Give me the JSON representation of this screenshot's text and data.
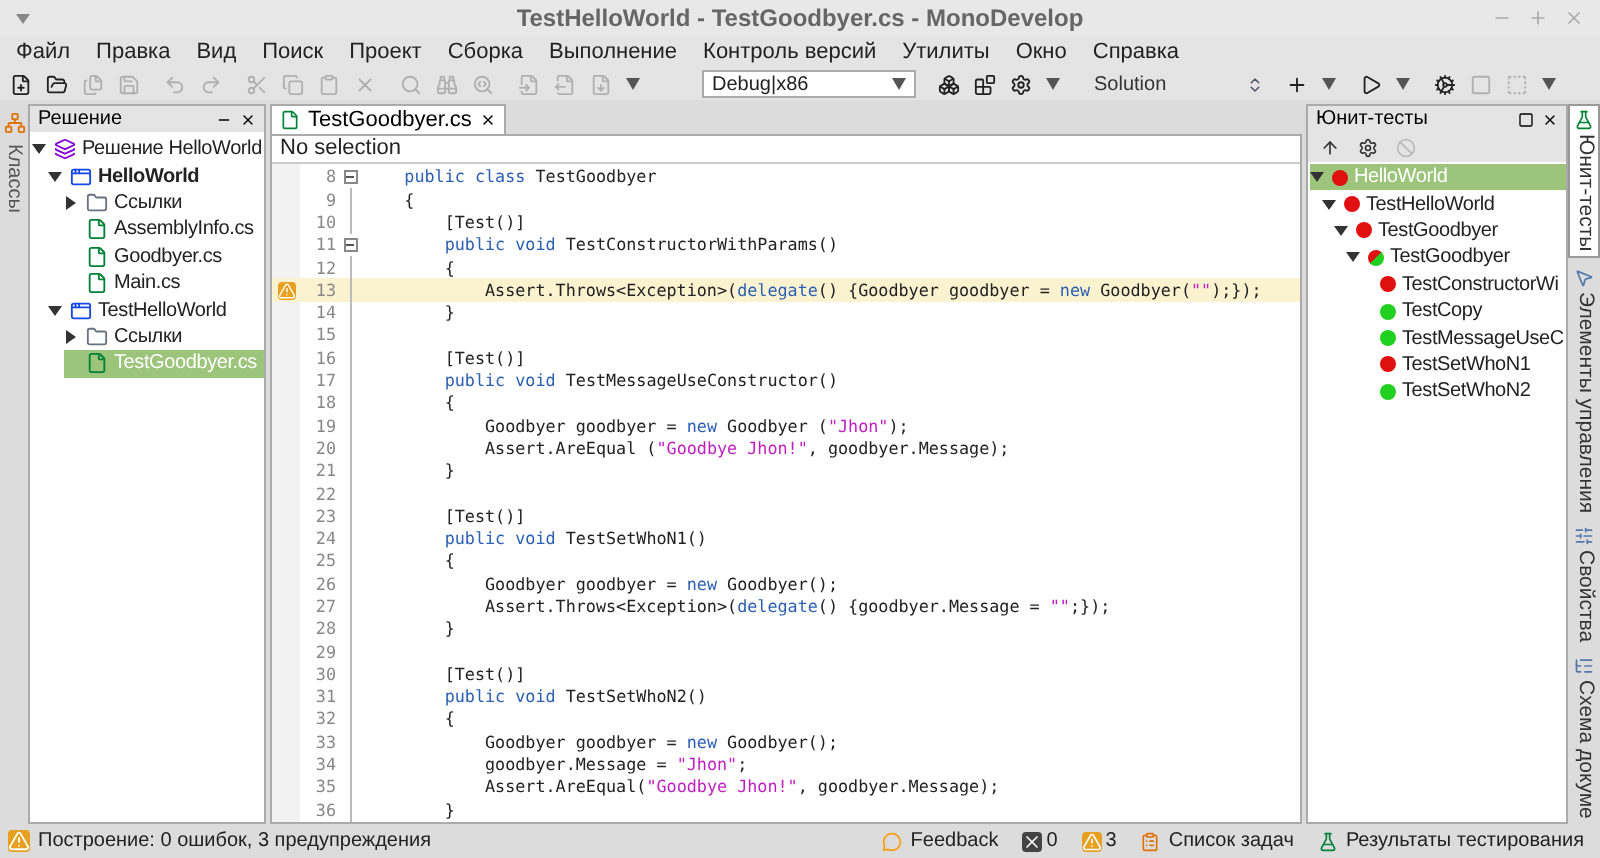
{
  "window": {
    "title": "TestHelloWorld - TestGoodbyer.cs - MonoDevelop"
  },
  "menu": [
    "Файл",
    "Правка",
    "Вид",
    "Поиск",
    "Проект",
    "Сборка",
    "Выполнение",
    "Контроль версий",
    "Утилиты",
    "Окно",
    "Справка"
  ],
  "toolbar": [
    {
      "items": [
        {
          "kind": "button",
          "disabled": false
        },
        {
          "kind": "button",
          "disabled": false
        },
        {
          "kind": "button",
          "disabled": true
        },
        {
          "kind": "button",
          "disabled": true
        }
      ]
    },
    {
      "items": [
        {
          "kind": "button",
          "disabled": true
        },
        {
          "kind": "button",
          "disabled": true
        }
      ]
    },
    {
      "items": [
        {
          "kind": "button",
          "disabled": true
        },
        {
          "kind": "button",
          "disabled": true
        },
        {
          "kind": "button",
          "disabled": true
        },
        {
          "kind": "button",
          "disabled": true
        }
      ]
    },
    {
      "items": [
        {
          "kind": "button",
          "disabled": true
        },
        {
          "kind": "button",
          "disabled": true
        },
        {
          "kind": "button",
          "disabled": true
        }
      ]
    },
    {
      "items": [
        {
          "kind": "button",
          "disabled": true
        },
        {
          "kind": "button",
          "disabled": true
        },
        {
          "kind": "button",
          "disabled": true
        },
        {
          "kind": "menu",
          "disabled": false
        }
      ]
    },
    {
      "items": [
        {
          "kind": "combo",
          "value": "Debug|x86"
        }
      ]
    },
    {
      "items": [
        {
          "kind": "button",
          "disabled": false
        },
        {
          "kind": "button",
          "disabled": false
        },
        {
          "kind": "button",
          "disabled": false
        },
        {
          "kind": "menu",
          "disabled": false
        }
      ]
    },
    {
      "items": [
        {
          "kind": "label",
          "text": "Solution"
        }
      ]
    },
    {
      "items": [
        {
          "kind": "button",
          "disabled": false
        },
        {
          "kind": "menu",
          "disabled": false
        }
      ]
    },
    {
      "items": [
        {
          "kind": "button",
          "disabled": false
        },
        {
          "kind": "menu",
          "disabled": false
        }
      ]
    },
    {
      "items": [
        {
          "kind": "button",
          "disabled": false
        },
        {
          "kind": "button",
          "disabled": true
        },
        {
          "kind": "button",
          "disabled": true
        },
        {
          "kind": "menu",
          "disabled": false
        }
      ]
    }
  ],
  "left_strip": {
    "tabs": [
      {
        "label": "Классы",
        "selected": false
      }
    ]
  },
  "solution_panel": {
    "title": "Решение",
    "tree": [
      {
        "label": "Решение HelloWorld",
        "kind": "solution",
        "selected": false,
        "expanded": true,
        "children": [
          {
            "label": "HelloWorld",
            "kind": "project",
            "startup": true,
            "selected": false,
            "expanded": true,
            "children": [
              {
                "label": "Ссылки",
                "kind": "folder",
                "selected": false,
                "expanded": false
              },
              {
                "label": "AssemblyInfo.cs",
                "kind": "file",
                "selected": false
              },
              {
                "label": "Goodbyer.cs",
                "kind": "file",
                "selected": false
              },
              {
                "label": "Main.cs",
                "kind": "file",
                "selected": false
              }
            ]
          },
          {
            "label": "TestHelloWorld",
            "kind": "project",
            "startup": false,
            "selected": false,
            "expanded": true,
            "children": [
              {
                "label": "Ссылки",
                "kind": "folder",
                "selected": false,
                "expanded": false
              },
              {
                "label": "TestGoodbyer.cs",
                "kind": "file",
                "selected": true
              }
            ]
          }
        ]
      }
    ]
  },
  "editor": {
    "tabs": [
      {
        "label": "TestGoodbyer.cs",
        "selected": true
      }
    ],
    "breadcrumb": "No selection",
    "lines": [
      {
        "number": "8",
        "fold": true,
        "current": false,
        "warning": false,
        "tokens": [
          {
            "kind": "keyword",
            "text": "    public class"
          },
          {
            "kind": "plain",
            "text": " TestGoodbyer"
          }
        ]
      },
      {
        "number": "9",
        "fold": false,
        "current": false,
        "warning": false,
        "tokens": [
          {
            "kind": "plain",
            "text": "    {"
          }
        ]
      },
      {
        "number": "10",
        "fold": false,
        "current": false,
        "warning": false,
        "tokens": [
          {
            "kind": "plain",
            "text": "        [Test()]"
          }
        ]
      },
      {
        "number": "11",
        "fold": true,
        "current": false,
        "warning": false,
        "tokens": [
          {
            "kind": "keyword",
            "text": "        public void"
          },
          {
            "kind": "plain",
            "text": " TestConstructorWithParams()"
          }
        ]
      },
      {
        "number": "12",
        "fold": false,
        "current": false,
        "warning": false,
        "tokens": [
          {
            "kind": "plain",
            "text": "        {"
          }
        ]
      },
      {
        "number": "13",
        "fold": false,
        "current": true,
        "warning": true,
        "tokens": [
          {
            "kind": "plain",
            "text": "            Assert.Throws<Exception>("
          },
          {
            "kind": "keyword",
            "text": "delegate"
          },
          {
            "kind": "plain",
            "text": "() {Goodbyer goodbyer = "
          },
          {
            "kind": "keyword",
            "text": "new"
          },
          {
            "kind": "plain",
            "text": " Goodbyer("
          },
          {
            "kind": "string",
            "text": "\"\""
          },
          {
            "kind": "plain",
            "text": ");});"
          }
        ]
      },
      {
        "number": "14",
        "fold": false,
        "current": false,
        "warning": false,
        "tokens": [
          {
            "kind": "plain",
            "text": "        }"
          }
        ]
      },
      {
        "number": "15",
        "fold": false,
        "current": false,
        "warning": false
      },
      {
        "number": "16",
        "fold": false,
        "current": false,
        "warning": false,
        "tokens": [
          {
            "kind": "plain",
            "text": "        [Test()]"
          }
        ]
      },
      {
        "number": "17",
        "fold": false,
        "current": false,
        "warning": false,
        "tokens": [
          {
            "kind": "keyword",
            "text": "        public void"
          },
          {
            "kind": "plain",
            "text": " TestMessageUseConstructor()"
          }
        ]
      },
      {
        "number": "18",
        "fold": false,
        "current": false,
        "warning": false,
        "tokens": [
          {
            "kind": "plain",
            "text": "        {"
          }
        ]
      },
      {
        "number": "19",
        "fold": false,
        "current": false,
        "warning": false,
        "tokens": [
          {
            "kind": "plain",
            "text": "            Goodbyer goodbyer = "
          },
          {
            "kind": "keyword",
            "text": "new"
          },
          {
            "kind": "plain",
            "text": " Goodbyer ("
          },
          {
            "kind": "string",
            "text": "\"Jhon\""
          },
          {
            "kind": "plain",
            "text": ");"
          }
        ]
      },
      {
        "number": "20",
        "fold": false,
        "current": false,
        "warning": false,
        "tokens": [
          {
            "kind": "plain",
            "text": "            Assert.AreEqual ("
          },
          {
            "kind": "string",
            "text": "\"Goodbye Jhon!\""
          },
          {
            "kind": "plain",
            "text": ", goodbyer.Message);"
          }
        ]
      },
      {
        "number": "21",
        "fold": false,
        "current": false,
        "warning": false,
        "tokens": [
          {
            "kind": "plain",
            "text": "        }"
          }
        ]
      },
      {
        "number": "22",
        "fold": false,
        "current": false,
        "warning": false
      },
      {
        "number": "23",
        "fold": false,
        "current": false,
        "warning": false,
        "tokens": [
          {
            "kind": "plain",
            "text": "        [Test()]"
          }
        ]
      },
      {
        "number": "24",
        "fold": false,
        "current": false,
        "warning": false,
        "tokens": [
          {
            "kind": "keyword",
            "text": "        public void"
          },
          {
            "kind": "plain",
            "text": " TestSetWhoN1()"
          }
        ]
      },
      {
        "number": "25",
        "fold": false,
        "current": false,
        "warning": false,
        "tokens": [
          {
            "kind": "plain",
            "text": "        {"
          }
        ]
      },
      {
        "number": "26",
        "fold": false,
        "current": false,
        "warning": false,
        "tokens": [
          {
            "kind": "plain",
            "text": "            Goodbyer goodbyer = "
          },
          {
            "kind": "keyword",
            "text": "new"
          },
          {
            "kind": "plain",
            "text": " Goodbyer();"
          }
        ]
      },
      {
        "number": "27",
        "fold": false,
        "current": false,
        "warning": false,
        "tokens": [
          {
            "kind": "plain",
            "text": "            Assert.Throws<Exception>("
          },
          {
            "kind": "keyword",
            "text": "delegate"
          },
          {
            "kind": "plain",
            "text": "() {goodbyer.Message = "
          },
          {
            "kind": "string",
            "text": "\"\""
          },
          {
            "kind": "plain",
            "text": ";});"
          }
        ]
      },
      {
        "number": "28",
        "fold": false,
        "current": false,
        "warning": false,
        "tokens": [
          {
            "kind": "plain",
            "text": "        }"
          }
        ]
      },
      {
        "number": "29",
        "fold": false,
        "current": false,
        "warning": false
      },
      {
        "number": "30",
        "fold": false,
        "current": false,
        "warning": false,
        "tokens": [
          {
            "kind": "plain",
            "text": "        [Test()]"
          }
        ]
      },
      {
        "number": "31",
        "fold": false,
        "current": false,
        "warning": false,
        "tokens": [
          {
            "kind": "keyword",
            "text": "        public void"
          },
          {
            "kind": "plain",
            "text": " TestSetWhoN2()"
          }
        ]
      },
      {
        "number": "32",
        "fold": false,
        "current": false,
        "warning": false,
        "tokens": [
          {
            "kind": "plain",
            "text": "        {"
          }
        ]
      },
      {
        "number": "33",
        "fold": false,
        "current": false,
        "warning": false,
        "tokens": [
          {
            "kind": "plain",
            "text": "            Goodbyer goodbyer = "
          },
          {
            "kind": "keyword",
            "text": "new"
          },
          {
            "kind": "plain",
            "text": " Goodbyer();"
          }
        ]
      },
      {
        "number": "34",
        "fold": false,
        "current": false,
        "warning": false,
        "tokens": [
          {
            "kind": "plain",
            "text": "            goodbyer.Message = "
          },
          {
            "kind": "string",
            "text": "\"Jhon\""
          },
          {
            "kind": "plain",
            "text": ";"
          }
        ]
      },
      {
        "number": "35",
        "fold": false,
        "current": false,
        "warning": false,
        "tokens": [
          {
            "kind": "plain",
            "text": "            Assert.AreEqual("
          },
          {
            "kind": "string",
            "text": "\"Goodbye Jhon!\""
          },
          {
            "kind": "plain",
            "text": ", goodbyer.Message);"
          }
        ]
      },
      {
        "number": "36",
        "fold": false,
        "current": false,
        "warning": false,
        "tokens": [
          {
            "kind": "plain",
            "text": "        }"
          }
        ]
      }
    ]
  },
  "tests_panel": {
    "title": "Юнит-тесты",
    "tree": [
      {
        "label": "HelloWorld",
        "failed": true,
        "passed": false,
        "selected": true,
        "expanded": true,
        "children": [
          {
            "label": "TestHelloWorld",
            "failed": true,
            "passed": false,
            "selected": false,
            "expanded": true,
            "children": [
              {
                "label": "TestGoodbyer",
                "failed": true,
                "passed": false,
                "selected": false,
                "expanded": true,
                "children": [
                  {
                    "label": "TestGoodbyer",
                    "failed": true,
                    "passed": true,
                    "selected": false,
                    "expanded": true,
                    "children": [
                      {
                        "label": "TestConstructorWi",
                        "failed": true,
                        "passed": false,
                        "selected": false
                      },
                      {
                        "label": "TestCopy",
                        "failed": false,
                        "passed": true,
                        "selected": false
                      },
                      {
                        "label": "TestMessageUseC",
                        "failed": false,
                        "passed": true,
                        "selected": false
                      },
                      {
                        "label": "TestSetWhoN1",
                        "failed": true,
                        "passed": false,
                        "selected": false
                      },
                      {
                        "label": "TestSetWhoN2",
                        "failed": false,
                        "passed": true,
                        "selected": false
                      }
                    ]
                  }
                ]
              }
            ]
          }
        ]
      }
    ]
  },
  "right_strip": {
    "tabs": [
      {
        "label": "Юнит-тесты",
        "selected": true
      },
      {
        "label": "Элементы управления",
        "selected": false
      },
      {
        "label": "Свойства",
        "selected": false
      },
      {
        "label": "Схема докуме",
        "selected": false
      }
    ]
  },
  "status_bar": {
    "message": "Построение: 0 ошибок, 3 предупреждения",
    "feedback": "Feedback",
    "errors": "0",
    "warnings": "3",
    "task_list": "Список задач",
    "test_results": "Результаты тестирования"
  }
}
